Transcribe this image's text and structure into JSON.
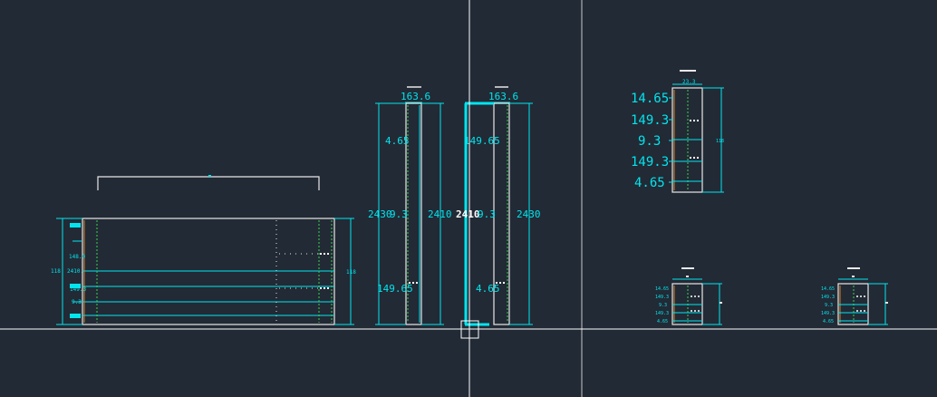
{
  "colors": {
    "background": "#222a35",
    "dimension": "#00e5ee",
    "outline": "#e8e8e8",
    "dotted_green": "#39d353",
    "edge_orange": "#d2822a",
    "crosshair": "#ffffff",
    "viewport_divider": "#c8c8c8"
  },
  "canvas": {
    "cursor_type": "crosshair-pickbox"
  },
  "drawings": {
    "panel_plan": {
      "left_labels": [
        "148.0",
        "2410.",
        "9.3",
        "149.3"
      ],
      "left_total": "118",
      "right_total": "118"
    },
    "elevation_a": {
      "top_label": "163.6",
      "left_dim": "2430",
      "right_dim": "2410",
      "mid_label": "9.3",
      "upper_label": "4.65",
      "lower_label": "149.65"
    },
    "elevation_b": {
      "top_label": "163.6",
      "left_dim": "2410",
      "right_dim": "2430",
      "mid_label": "9.3",
      "upper_label": "149.65",
      "lower_label": "4.65"
    },
    "section_large": {
      "top_label": "23.3",
      "right_dim": "118",
      "labels": [
        "14.65",
        "149.3",
        "9.3",
        "149.3",
        "4.65"
      ]
    },
    "section_small_1": {
      "labels": [
        "14.65",
        "149.3",
        "9.3",
        "149.3",
        "4.65"
      ]
    },
    "section_small_2": {
      "labels": [
        "14.65",
        "149.3",
        "9.3",
        "149.3",
        "4.65"
      ]
    }
  }
}
